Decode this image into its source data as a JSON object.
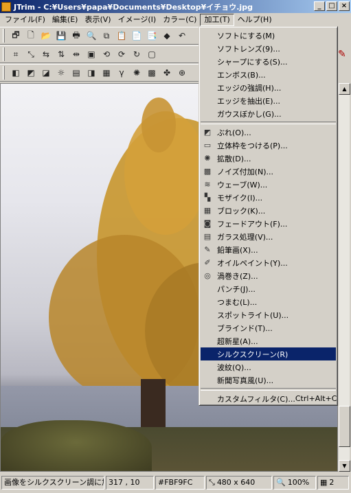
{
  "window": {
    "title": "JTrim - C:¥Users¥papa¥Documents¥Desktop¥イチョウ.jpg",
    "min_glyph": "_",
    "max_glyph": "□",
    "close_glyph": "×"
  },
  "menubar": {
    "items": [
      {
        "label": "ファイル(F)",
        "name": "menu-file"
      },
      {
        "label": "編集(E)",
        "name": "menu-edit"
      },
      {
        "label": "表示(V)",
        "name": "menu-view"
      },
      {
        "label": "イメージ(I)",
        "name": "menu-image"
      },
      {
        "label": "カラー(C)",
        "name": "menu-color"
      },
      {
        "label": "加工(T)",
        "name": "menu-process"
      },
      {
        "label": "ヘルプ(H)",
        "name": "menu-help"
      }
    ],
    "active_index": 5
  },
  "toolbars": {
    "row1": [
      {
        "name": "new-window-icon",
        "glyph": "🗗"
      },
      {
        "name": "new-file-icon",
        "glyph": "🗋"
      },
      {
        "name": "open-folder-icon",
        "glyph": "📂"
      },
      {
        "name": "save-icon",
        "glyph": "💾"
      },
      {
        "name": "print-icon",
        "glyph": "🖶"
      },
      {
        "name": "print-preview-icon",
        "glyph": "🔍"
      },
      {
        "name": "copy-icon",
        "glyph": "⧉"
      },
      {
        "name": "paste-icon",
        "glyph": "📋"
      },
      {
        "name": "paste-new-icon",
        "glyph": "📄"
      },
      {
        "name": "paste-merge-icon",
        "glyph": "📑"
      },
      {
        "name": "color-replace-icon",
        "glyph": "◆"
      },
      {
        "name": "undo-icon",
        "glyph": "↶"
      }
    ],
    "row2": [
      {
        "name": "crop-icon",
        "glyph": "⌗"
      },
      {
        "name": "trim-icon",
        "glyph": "⤡"
      },
      {
        "name": "flip-horizontal-icon",
        "glyph": "⇆"
      },
      {
        "name": "flip-vertical-icon",
        "glyph": "⇅"
      },
      {
        "name": "resize-icon",
        "glyph": "⇹"
      },
      {
        "name": "canvas-size-icon",
        "glyph": "▣"
      },
      {
        "name": "rotate-left-90-icon",
        "glyph": "⟲"
      },
      {
        "name": "rotate-right-90-icon",
        "glyph": "⟳"
      },
      {
        "name": "rotate-free-icon",
        "glyph": "↻"
      },
      {
        "name": "select-icon",
        "glyph": "▢"
      }
    ],
    "row3": [
      {
        "name": "grayscale-icon",
        "glyph": "◧"
      },
      {
        "name": "sepia-icon",
        "glyph": "◩"
      },
      {
        "name": "negative-icon",
        "glyph": "◪"
      },
      {
        "name": "brightness-icon",
        "glyph": "☼"
      },
      {
        "name": "color-balance-icon",
        "glyph": "▤"
      },
      {
        "name": "contrast-icon",
        "glyph": "◨"
      },
      {
        "name": "picture-icon",
        "glyph": "▦"
      },
      {
        "name": "gamma-icon",
        "glyph": "γ"
      },
      {
        "name": "color-wheel-icon",
        "glyph": "✺"
      },
      {
        "name": "mosaic-icon",
        "glyph": "▩"
      },
      {
        "name": "palette-icon",
        "glyph": "✤"
      },
      {
        "name": "xor-icon",
        "glyph": "⊕"
      }
    ]
  },
  "process_menu": {
    "items": [
      {
        "type": "item",
        "label": "ソフトにする(M)",
        "icon": "",
        "name": "menu-item-soften"
      },
      {
        "type": "item",
        "label": "ソフトレンズ(9)...",
        "icon": "",
        "name": "menu-item-soft-lens"
      },
      {
        "type": "item",
        "label": "シャープにする(S)...",
        "icon": "",
        "name": "menu-item-sharpen"
      },
      {
        "type": "item",
        "label": "エンボス(B)...",
        "icon": "",
        "name": "menu-item-emboss"
      },
      {
        "type": "item",
        "label": "エッジの強調(H)...",
        "icon": "",
        "name": "menu-item-edge-enhance"
      },
      {
        "type": "item",
        "label": "エッジを抽出(E)...",
        "icon": "",
        "name": "menu-item-edge-extract"
      },
      {
        "type": "item",
        "label": "ガウスぼかし(G)...",
        "icon": "",
        "name": "menu-item-gaussian-blur"
      },
      {
        "type": "separator"
      },
      {
        "type": "item",
        "label": "ぶれ(O)...",
        "icon": "◩",
        "name": "menu-item-motion-blur"
      },
      {
        "type": "item",
        "label": "立体枠をつける(P)...",
        "icon": "▭",
        "name": "menu-item-3d-frame"
      },
      {
        "type": "item",
        "label": "拡散(D)...",
        "icon": "✺",
        "name": "menu-item-diffuse"
      },
      {
        "type": "item",
        "label": "ノイズ付加(N)...",
        "icon": "▩",
        "name": "menu-item-add-noise"
      },
      {
        "type": "item",
        "label": "ウェーブ(W)...",
        "icon": "≋",
        "name": "menu-item-wave"
      },
      {
        "type": "item",
        "label": "モザイク(I)...",
        "icon": "▚",
        "name": "menu-item-mosaic"
      },
      {
        "type": "item",
        "label": "ブロック(K)...",
        "icon": "▦",
        "name": "menu-item-block"
      },
      {
        "type": "item",
        "label": "フェードアウト(F)...",
        "icon": "◙",
        "name": "menu-item-fade-out"
      },
      {
        "type": "item",
        "label": "ガラス処理(V)...",
        "icon": "▤",
        "name": "menu-item-glass"
      },
      {
        "type": "item",
        "label": "鉛筆画(X)...",
        "icon": "✎",
        "name": "menu-item-pencil-drawing"
      },
      {
        "type": "item",
        "label": "オイルペイント(Y)...",
        "icon": "✐",
        "name": "menu-item-oil-paint"
      },
      {
        "type": "item",
        "label": "渦巻き(Z)...",
        "icon": "◎",
        "name": "menu-item-swirl"
      },
      {
        "type": "item",
        "label": "パンチ(J)...",
        "icon": "",
        "name": "menu-item-punch"
      },
      {
        "type": "item",
        "label": "つまむ(L)...",
        "icon": "",
        "name": "menu-item-pinch"
      },
      {
        "type": "item",
        "label": "スポットライト(U)...",
        "icon": "",
        "name": "menu-item-spotlight"
      },
      {
        "type": "item",
        "label": "ブラインド(T)...",
        "icon": "",
        "name": "menu-item-blind"
      },
      {
        "type": "item",
        "label": "超新星(A)...",
        "icon": "",
        "name": "menu-item-supernova"
      },
      {
        "type": "item",
        "label": "シルクスクリーン(R)",
        "icon": "",
        "name": "menu-item-silkscreen",
        "selected": true
      },
      {
        "type": "item",
        "label": "波紋(Q)...",
        "icon": "",
        "name": "menu-item-ripple"
      },
      {
        "type": "item",
        "label": "新聞写真風(U)...",
        "icon": "",
        "name": "menu-item-newspaper-photo"
      },
      {
        "type": "separator"
      },
      {
        "type": "item",
        "label": "カスタムフィルタ(C)...",
        "icon": "",
        "name": "menu-item-custom-filter",
        "shortcut": "Ctrl+Alt+C"
      }
    ]
  },
  "statusbar": {
    "message": "画像をシルクスクリーン調に加工",
    "coords": "317 , 10",
    "color": "#FBF9FC",
    "size": "480 x 640",
    "zoom": "100%",
    "layers": "2"
  },
  "colors": {
    "selection": "#0a246a",
    "title_start": "#0a246a",
    "title_end": "#a6caf0"
  }
}
